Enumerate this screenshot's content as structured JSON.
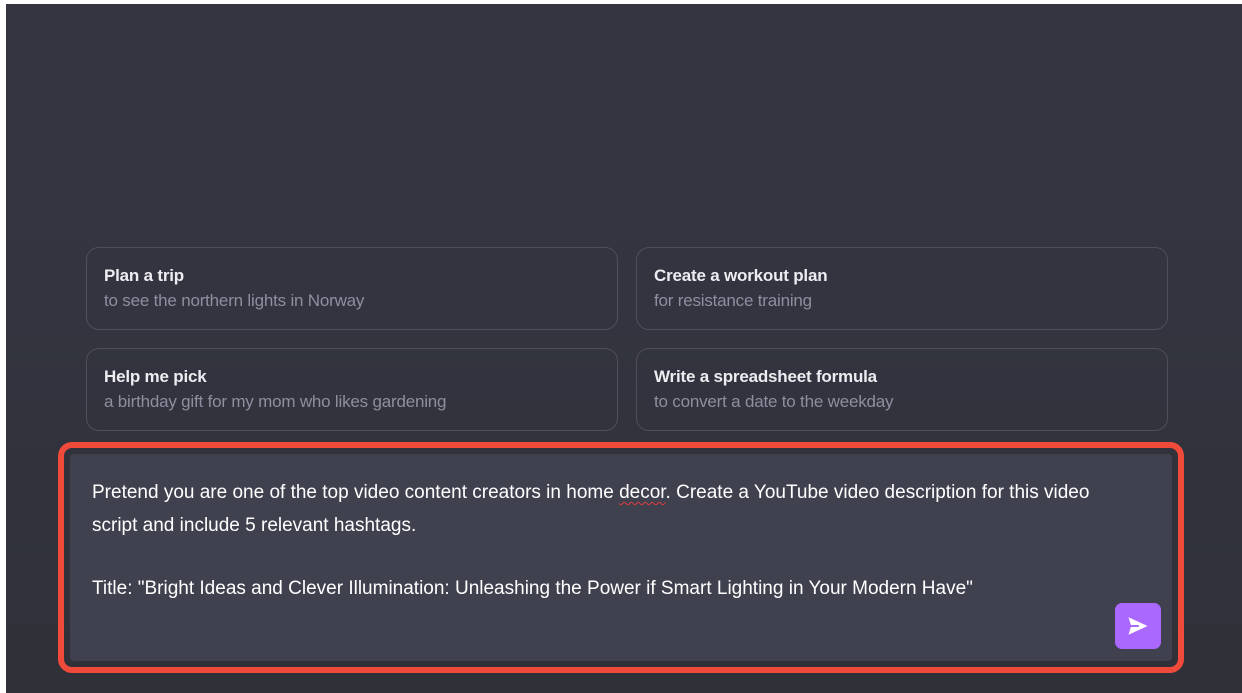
{
  "suggestions": [
    {
      "title": "Plan a trip",
      "subtitle": "to see the northern lights in Norway"
    },
    {
      "title": "Create a workout plan",
      "subtitle": "for resistance training"
    },
    {
      "title": "Help me pick",
      "subtitle": "a birthday gift for my mom who likes gardening"
    },
    {
      "title": "Write a spreadsheet formula",
      "subtitle": "to convert a date to the weekday"
    }
  ],
  "composer": {
    "line1_before": "Pretend you are one of the top video content creators in home ",
    "line1_flagged": "decor",
    "line1_after": ". Create a YouTube video description for this video script and include 5 relevant hashtags.",
    "line2": "Title: \"Bright Ideas and Clever Illumination: Unleashing the Power if Smart Lighting in Your Modern Have\""
  },
  "icons": {
    "send": "send-icon"
  },
  "colors": {
    "background": "#343541",
    "composer_bg": "#40414f",
    "send_button": "#ab68ff",
    "highlight_border": "#f04a3a"
  }
}
